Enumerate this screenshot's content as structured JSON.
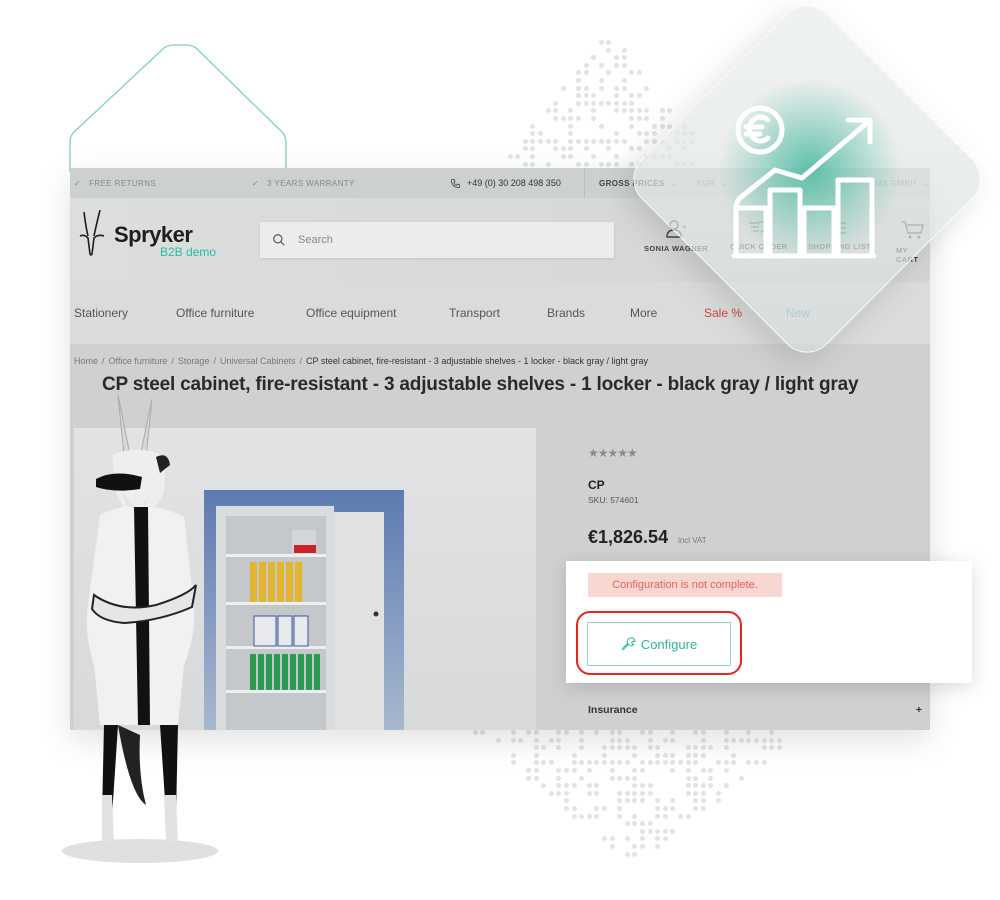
{
  "topbar": {
    "usp_1": "Free returns",
    "usp_2": "3 years warranty",
    "phone": "+49 (0) 30 208 498 350",
    "price_mode": "Gross prices",
    "currency": "EUR",
    "company": "Systems GmbH"
  },
  "header": {
    "logo_brand": "Spryker",
    "logo_sub": "B2B demo",
    "search_placeholder": "Search",
    "user_name": "Sonia Wagner",
    "quick_order": "Quick order",
    "shopping_list": "Shopping list",
    "cart": "My cart"
  },
  "main_nav": [
    {
      "label": "Stationery"
    },
    {
      "label": "Office furniture"
    },
    {
      "label": "Office equipment"
    },
    {
      "label": "Transport"
    },
    {
      "label": "Brands"
    },
    {
      "label": "More"
    },
    {
      "label": "Sale %"
    },
    {
      "label": "New"
    }
  ],
  "breadcrumb": [
    {
      "label": "Home"
    },
    {
      "label": "Office furniture"
    },
    {
      "label": "Storage"
    },
    {
      "label": "Universal Cabinets"
    },
    {
      "label": "CP steel cabinet, fire-resistant - 3 adjustable shelves - 1 locker - black gray / light gray"
    }
  ],
  "breadcrumb_sep": "/",
  "product": {
    "title": "CP steel cabinet, fire-resistant - 3 adjustable shelves - 1 locker - black gray / light gray",
    "rating_stars": "★★★★★",
    "rating": 0,
    "brand": "CP",
    "sku": "SKU: 574601",
    "price": "€1,826.54",
    "price_note": "incl VAT",
    "insurance_label": "Insurance",
    "insurance_toggle": "+"
  },
  "configurator": {
    "alert": "Configuration is not complete.",
    "button_label": "Configure"
  },
  "icons": {
    "check": "check-icon",
    "phone": "phone-icon",
    "search": "search-icon",
    "user": "user-icon",
    "cart": "cart-icon",
    "wrench": "wrench-icon",
    "finance": "euro-growth-chart-icon"
  },
  "colors": {
    "accent": "#1ebea5",
    "sale": "#d0403a",
    "new": "#47b39a",
    "alert_bg": "#f8d7d3",
    "alert_text": "#e0645a",
    "highlight": "#e8251c"
  }
}
